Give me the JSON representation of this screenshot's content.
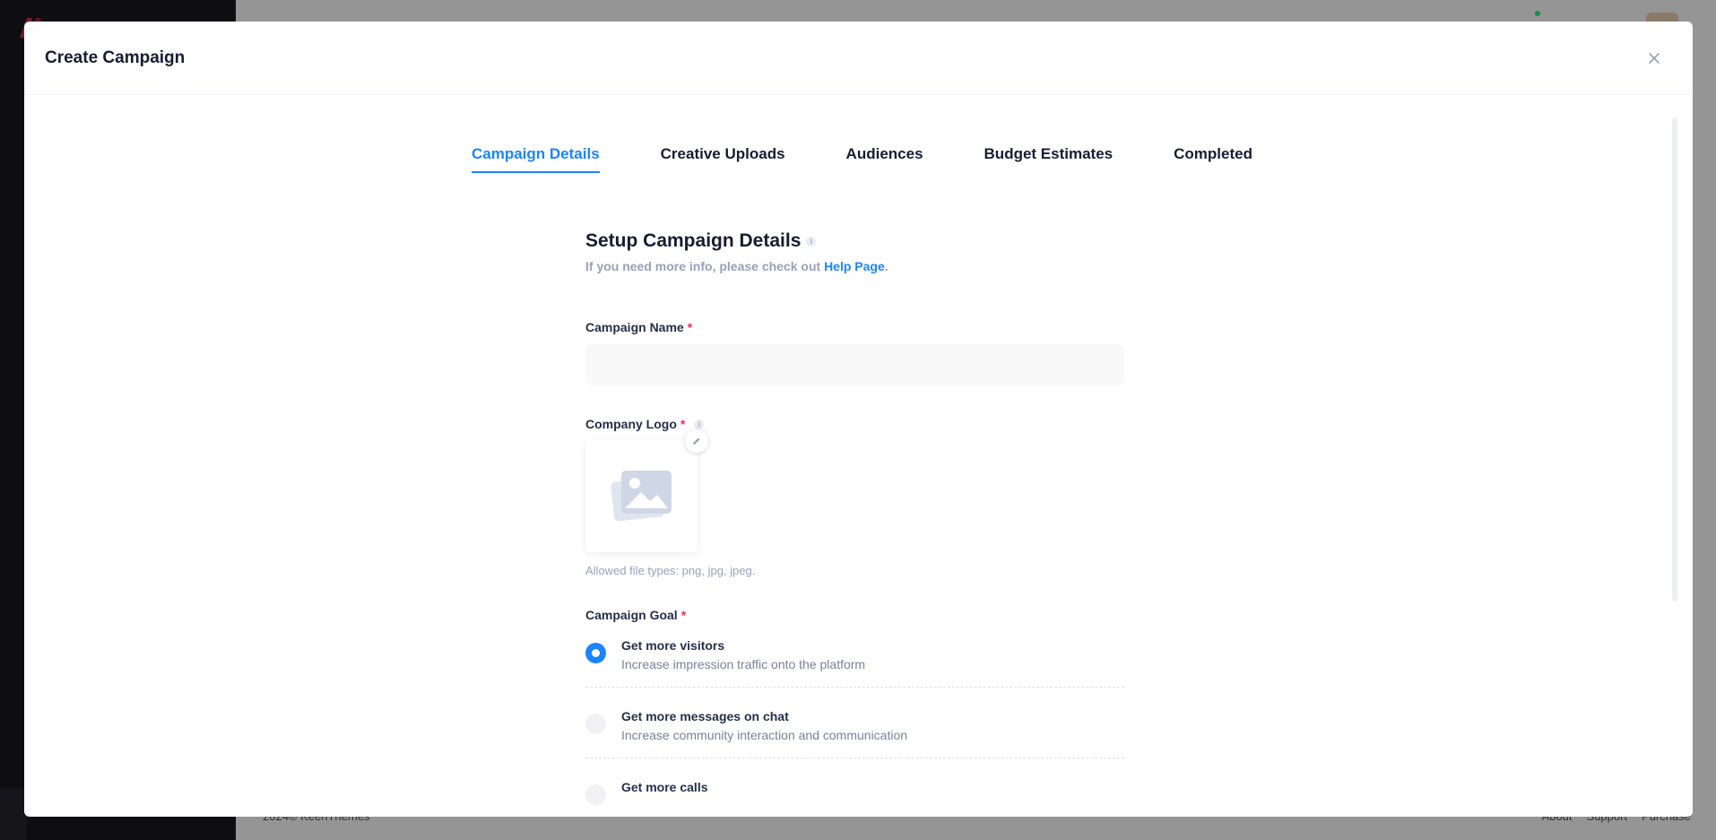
{
  "modal": {
    "title": "Create Campaign"
  },
  "tabs": [
    {
      "label": "Campaign Details",
      "active": true
    },
    {
      "label": "Creative Uploads",
      "active": false
    },
    {
      "label": "Audiences",
      "active": false
    },
    {
      "label": "Budget Estimates",
      "active": false
    },
    {
      "label": "Completed",
      "active": false
    }
  ],
  "form": {
    "title": "Setup Campaign Details",
    "subtitle_prefix": "If you need more info, please check out ",
    "help_link": "Help Page",
    "subtitle_suffix": ".",
    "campaign_name_label": "Campaign Name",
    "required_mark": "*",
    "campaign_name_value": "",
    "company_logo_label": "Company Logo",
    "logo_hint": "Allowed file types: png, jpg, jpeg.",
    "campaign_goal_label": "Campaign Goal",
    "goals": [
      {
        "title": "Get more visitors",
        "desc": "Increase impression traffic onto the platform",
        "checked": true
      },
      {
        "title": "Get more messages on chat",
        "desc": "Increase community interaction and communication",
        "checked": false
      },
      {
        "title": "Get more calls",
        "desc": "",
        "checked": false
      }
    ]
  },
  "background": {
    "footer_left": "2024© KeenThemes",
    "footer_links": [
      "About",
      "Support",
      "Purchase"
    ]
  },
  "colors": {
    "accent": "#1b84ff",
    "required": "#f8285a"
  }
}
